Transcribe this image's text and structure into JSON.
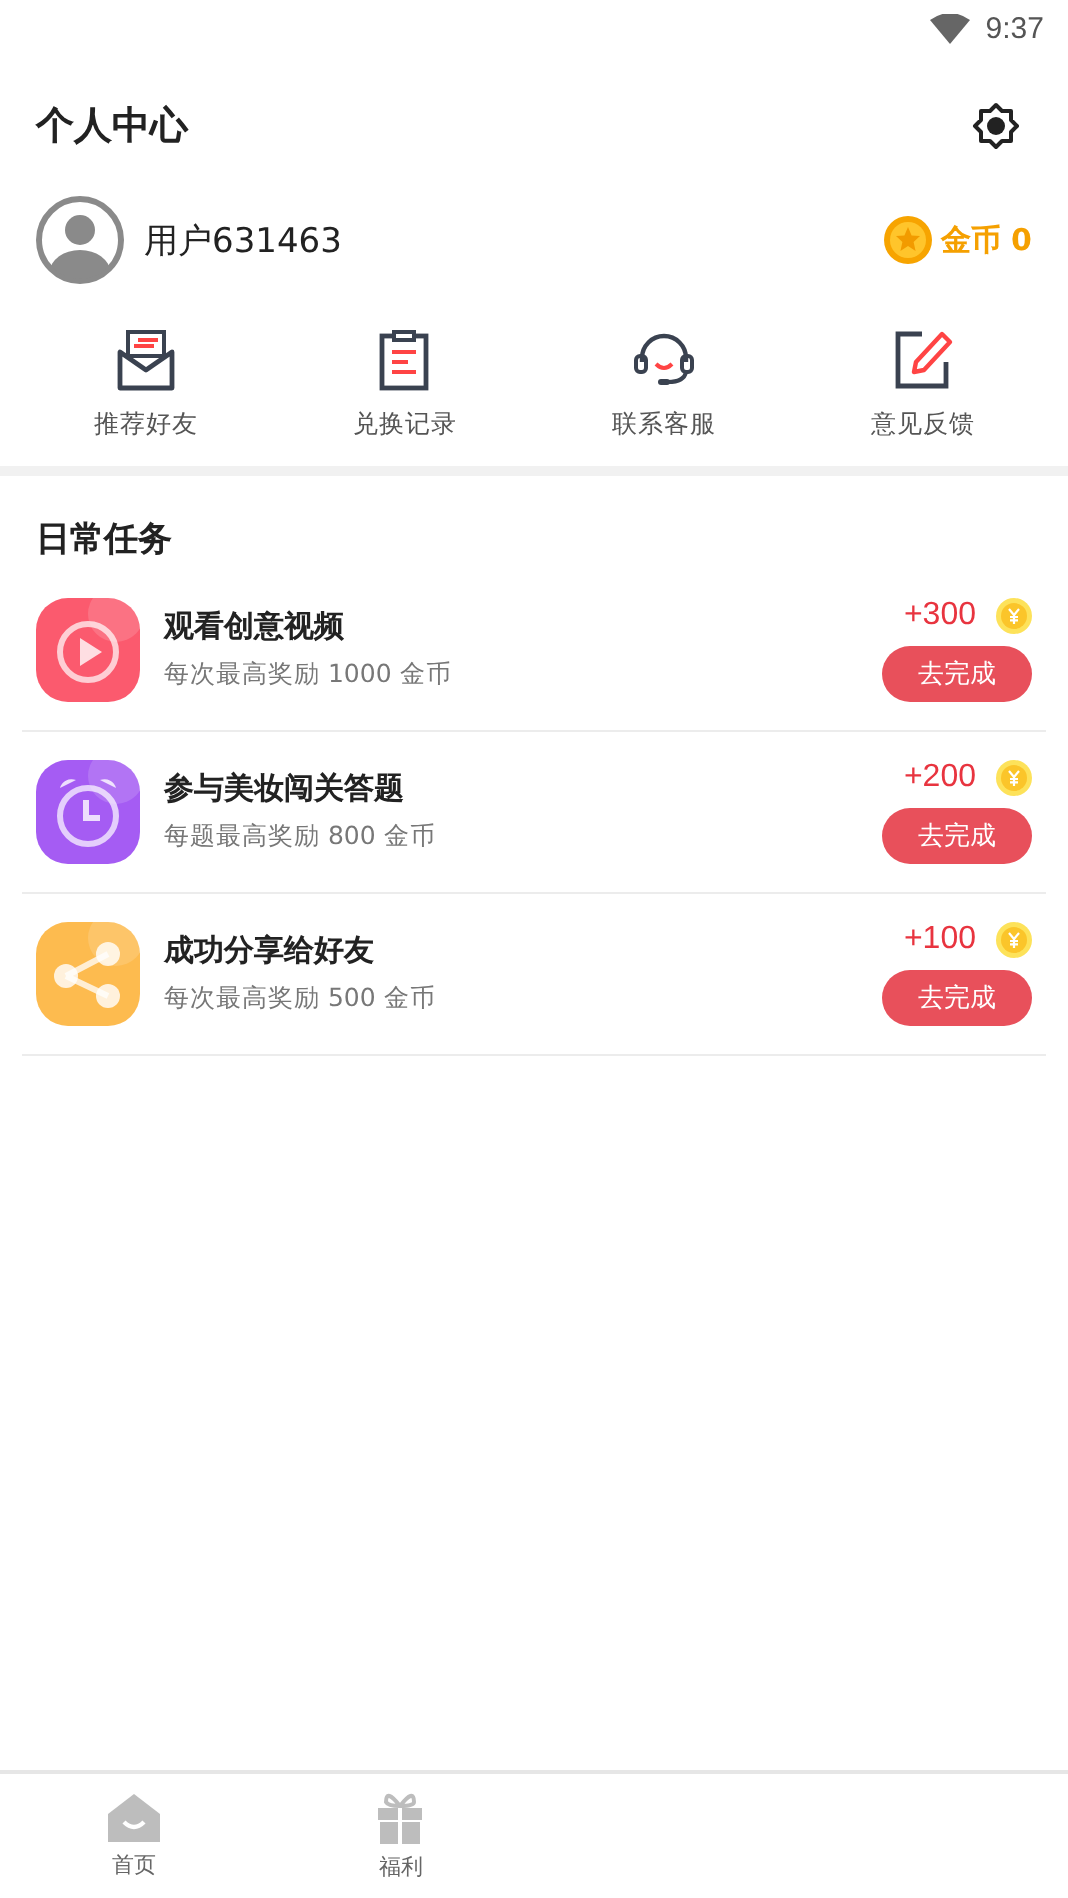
{
  "status_bar": {
    "time": "9:37"
  },
  "header": {
    "title": "个人中心"
  },
  "user": {
    "name": "用户631463",
    "coins_label": "金币 0"
  },
  "shortcuts": [
    {
      "kind": "invite",
      "label": "推荐好友"
    },
    {
      "kind": "records",
      "label": "兑换记录"
    },
    {
      "kind": "service",
      "label": "联系客服"
    },
    {
      "kind": "feedback",
      "label": "意见反馈"
    }
  ],
  "daily_tasks": {
    "title": "日常任务",
    "tasks": [
      {
        "kind": "video",
        "color": "#fb5a6e",
        "title": "观看创意视频",
        "subtitle": "每次最高奖励 1000 金币",
        "reward": "+300",
        "button": "去完成"
      },
      {
        "kind": "quiz",
        "color": "#a55cf3",
        "title": "参与美妆闯关答题",
        "subtitle": "每题最高奖励 800 金币",
        "reward": "+200",
        "button": "去完成"
      },
      {
        "kind": "share",
        "color": "#fdbb4f",
        "title": "成功分享给好友",
        "subtitle": "每次最高奖励 500 金币",
        "reward": "+100",
        "button": "去完成"
      }
    ]
  },
  "bottom_nav": [
    {
      "kind": "home",
      "label": "首页",
      "selected": false
    },
    {
      "kind": "gift",
      "label": "福利",
      "selected": false
    }
  ]
}
